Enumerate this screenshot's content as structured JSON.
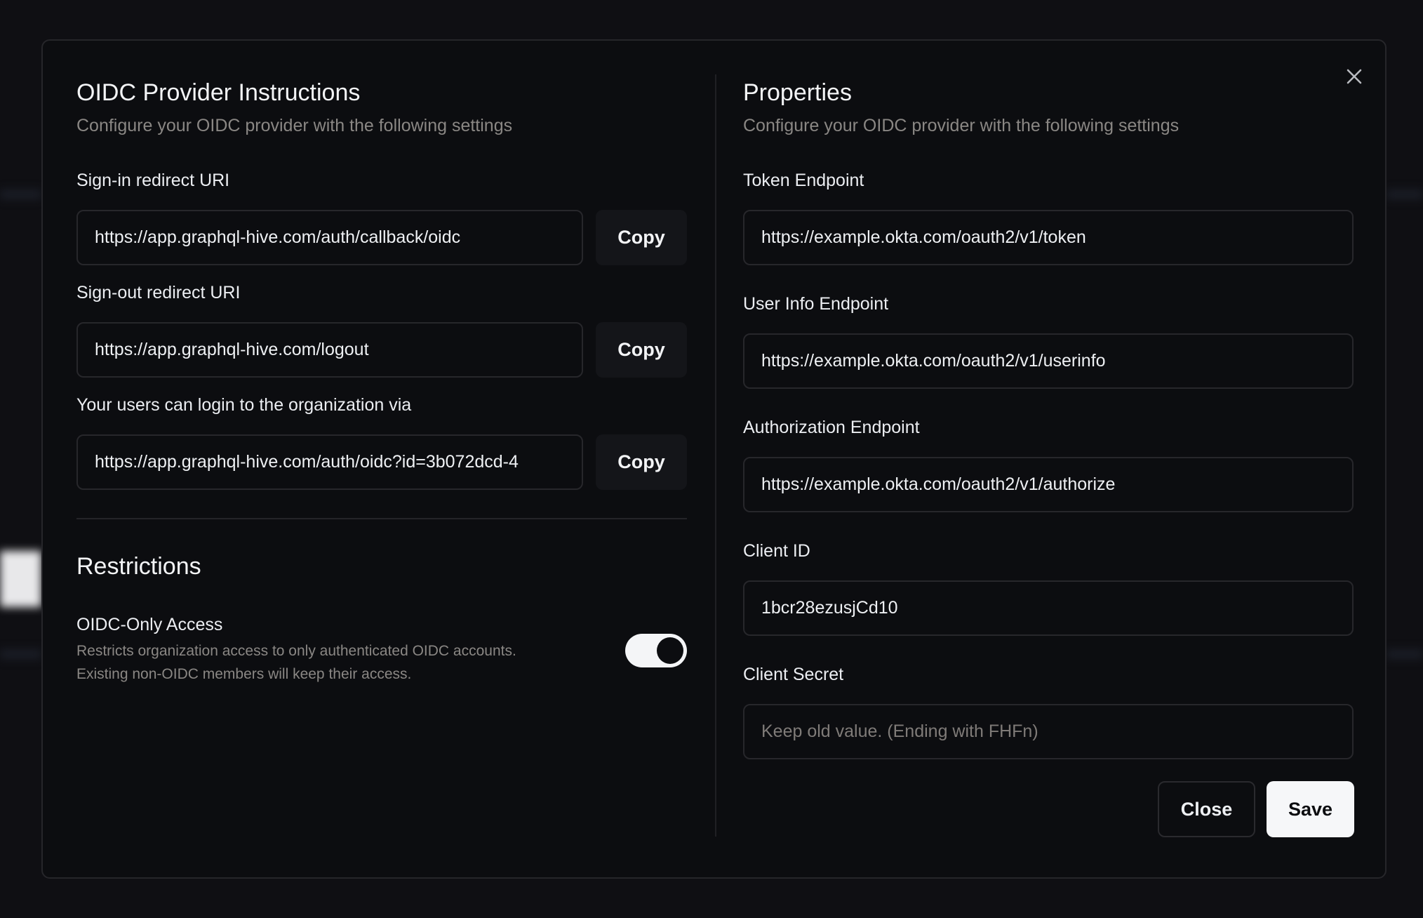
{
  "left": {
    "title": "OIDC Provider Instructions",
    "subtitle": "Configure your OIDC provider with the following settings",
    "fields": [
      {
        "label": "Sign-in redirect URI",
        "value": "https://app.graphql-hive.com/auth/callback/oidc",
        "copy_label": "Copy"
      },
      {
        "label": "Sign-out redirect URI",
        "value": "https://app.graphql-hive.com/logout",
        "copy_label": "Copy"
      },
      {
        "label": "Your users can login to the organization via",
        "value": "https://app.graphql-hive.com/auth/oidc?id=3b072dcd-4",
        "copy_label": "Copy"
      }
    ],
    "restrictions": {
      "title": "Restrictions",
      "oidc_only": {
        "label": "OIDC-Only Access",
        "description_1": "Restricts organization access to only authenticated OIDC accounts.",
        "description_2": "Existing non-OIDC members will keep their access.",
        "enabled": true
      }
    }
  },
  "right": {
    "title": "Properties",
    "subtitle": "Configure your OIDC provider with the following settings",
    "fields": [
      {
        "label": "Token Endpoint",
        "value": "https://example.okta.com/oauth2/v1/token"
      },
      {
        "label": "User Info Endpoint",
        "value": "https://example.okta.com/oauth2/v1/userinfo"
      },
      {
        "label": "Authorization Endpoint",
        "value": "https://example.okta.com/oauth2/v1/authorize"
      },
      {
        "label": "Client ID",
        "value": "1bcr28ezusjCd10"
      },
      {
        "label": "Client Secret",
        "value": "",
        "placeholder": "Keep old value. (Ending with FHFn)"
      }
    ],
    "close_label": "Close",
    "save_label": "Save"
  },
  "icons": {
    "dismiss": "close-x-icon"
  },
  "colors": {
    "background": "#0c0d10",
    "border": "#27272b",
    "primary_button": "#f6f7f9",
    "muted_text": "#8a8784"
  }
}
